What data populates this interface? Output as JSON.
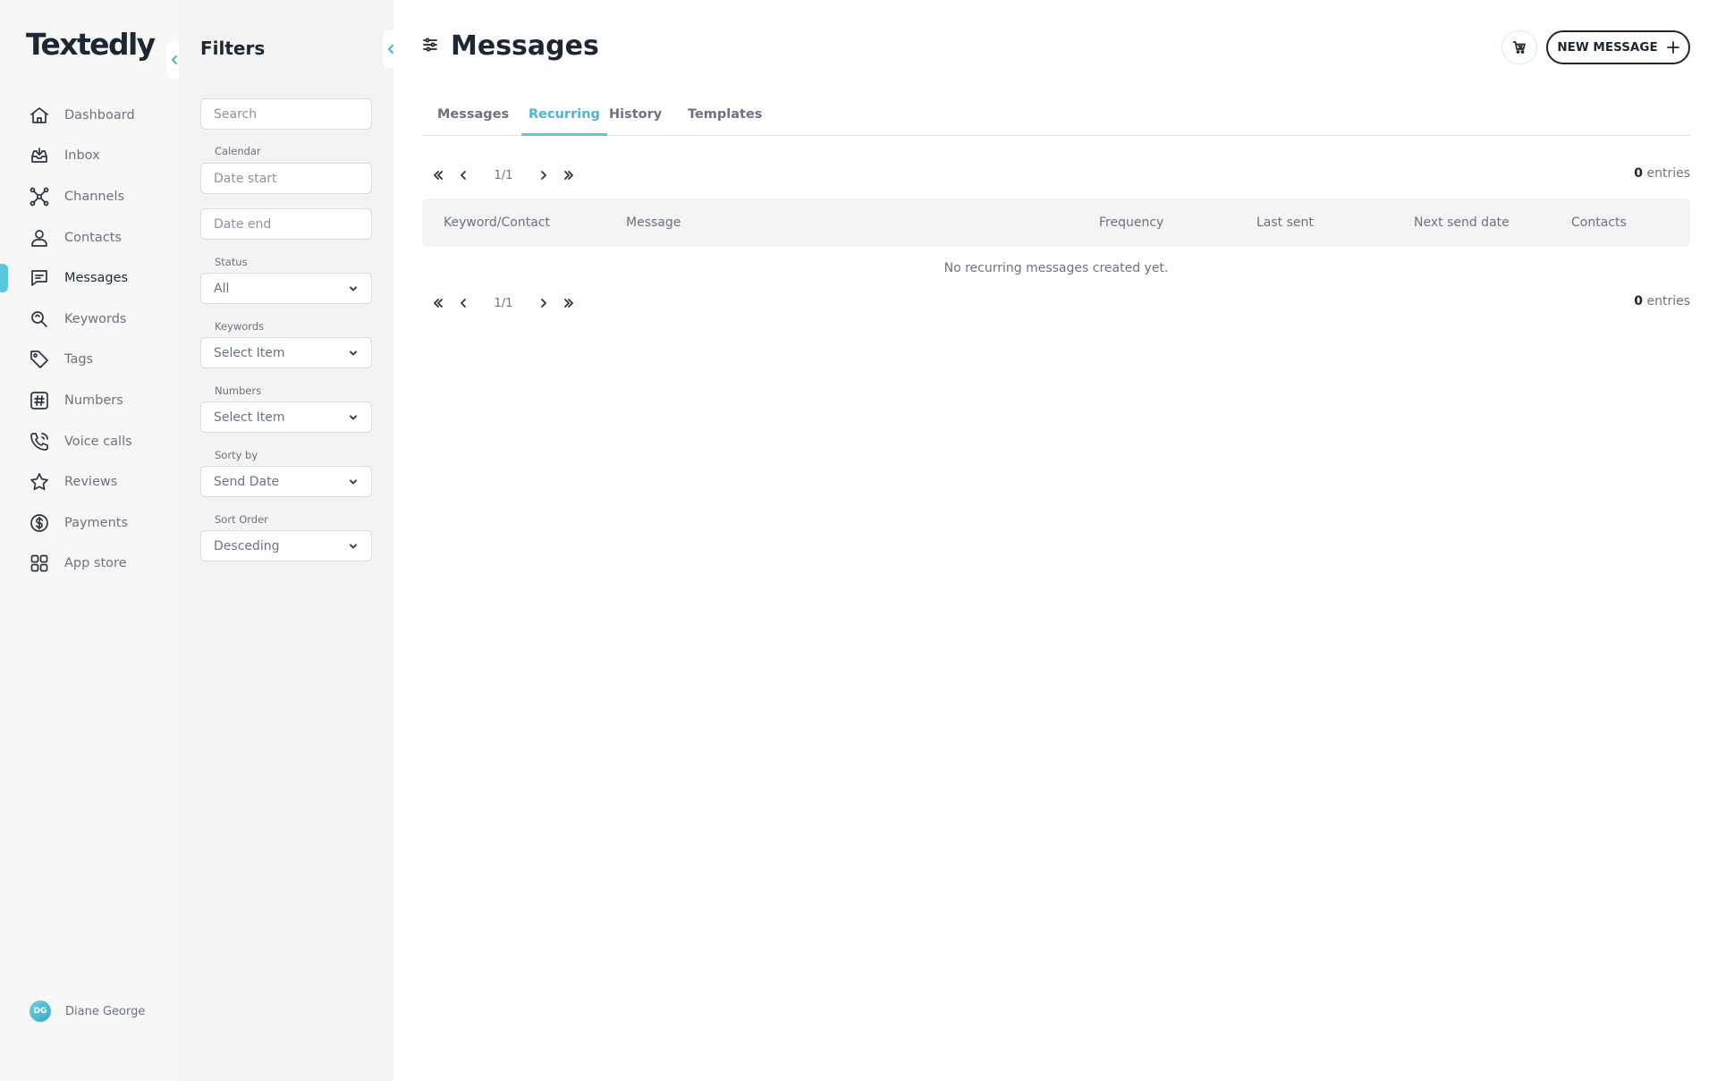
{
  "app": {
    "logo": "Textedly"
  },
  "sidebar": {
    "items": [
      {
        "label": "Dashboard",
        "icon": "home-icon"
      },
      {
        "label": "Inbox",
        "icon": "inbox-icon"
      },
      {
        "label": "Channels",
        "icon": "channels-icon"
      },
      {
        "label": "Contacts",
        "icon": "user-icon"
      },
      {
        "label": "Messages",
        "icon": "message-icon"
      },
      {
        "label": "Keywords",
        "icon": "keywords-icon"
      },
      {
        "label": "Tags",
        "icon": "tag-icon"
      },
      {
        "label": "Numbers",
        "icon": "hash-icon"
      },
      {
        "label": "Voice calls",
        "icon": "phone-icon"
      },
      {
        "label": "Reviews",
        "icon": "star-icon"
      },
      {
        "label": "Payments",
        "icon": "dollar-icon"
      },
      {
        "label": "App store",
        "icon": "grid-icon"
      }
    ],
    "active": "Messages",
    "accent": "#5bc6dc",
    "user": {
      "initials": "DG",
      "name": "Diane George"
    }
  },
  "filters": {
    "title": "Filters",
    "search_placeholder": "Search",
    "calendar_label": "Calendar",
    "date_start_placeholder": "Date start",
    "date_end_placeholder": "Date end",
    "status_label": "Status",
    "status_value": "All",
    "keywords_label": "Keywords",
    "keywords_value": "Select Item",
    "numbers_label": "Numbers",
    "numbers_value": "Select Item",
    "sort_by_label": "Sorty by",
    "sort_by_value": "Send Date",
    "sort_order_label": "Sort Order",
    "sort_order_value": "Desceding"
  },
  "header": {
    "title": "Messages",
    "new_message_label": "NEW MESSAGE"
  },
  "tabs": [
    {
      "label": "Messages"
    },
    {
      "label": "Recurring"
    },
    {
      "label": "History"
    },
    {
      "label": "Templates"
    }
  ],
  "active_tab": "Recurring",
  "pagination": {
    "page": "1/1",
    "entries_count": "0",
    "entries_label": "entries"
  },
  "table": {
    "columns": [
      "Keyword/Contact",
      "Message",
      "Frequency",
      "Last sent",
      "Next send date",
      "Contacts"
    ],
    "empty_message": "No recurring messages created yet."
  }
}
